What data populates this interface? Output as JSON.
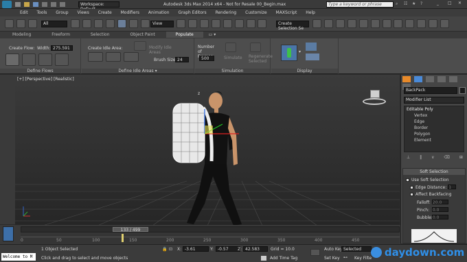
{
  "titlebar": {
    "workspace": "Workspace: Default",
    "title": "Autodesk 3ds Max  2014 x64  - Not for Resale   00_Begin.max",
    "search_placeholder": "Type a keyword or phrase"
  },
  "menu": [
    "Edit",
    "Tools",
    "Group",
    "Views",
    "Create",
    "Modifiers",
    "Animation",
    "Graph Editors",
    "Rendering",
    "Customize",
    "MAXScript",
    "Help"
  ],
  "toolbar": {
    "selection_filter": "All",
    "ref_coord": "View",
    "named_selection": "Create Selection Se"
  },
  "ribbon": {
    "tabs": [
      "Modeling",
      "Freeform",
      "Selection",
      "Object Paint",
      "Populate"
    ],
    "active_tab": "Populate",
    "create_flow_label": "Create Flow:",
    "width_label": "Width:",
    "width_value": "275.591",
    "create_idle_label": "Create Idle Area:",
    "modify_idle_label": "Modify Idle Areas",
    "brush_size_label": "Brush Size:",
    "brush_size_value": "24",
    "frames_label": "Number of Frames:",
    "frames_value": "500",
    "simulate_label": "Simulate",
    "regenerate_label": "Regenerate Selected",
    "groups": [
      "Define Flows",
      "Define Idle Areas",
      "Simulation",
      "Display"
    ]
  },
  "viewport": {
    "label": "[+] [Perspective] [Realistic]",
    "gizmo_label": "z"
  },
  "cmdpanel": {
    "object_name": "BackPack",
    "modifier_list": "Modifier List",
    "stack": [
      "Editable Poly",
      "Vertex",
      "Edge",
      "Border",
      "Polygon",
      "Element"
    ],
    "rollout_title": "Soft Selection",
    "use_soft": "Use Soft Selection",
    "edge_distance": "Edge Distance:",
    "edge_distance_value": "1",
    "affect_backfacing": "Affect Backfacing",
    "falloff": "Falloff:",
    "falloff_value": "20.0",
    "pinch": "Pinch:",
    "pinch_value": "0.0",
    "bubble": "Bubble:",
    "bubble_value": "0.0"
  },
  "timeline": {
    "frame_display": "133 / 499",
    "ticks": [
      "0",
      "50",
      "100",
      "150",
      "200",
      "250",
      "300",
      "350",
      "400",
      "450"
    ],
    "current_frame_fraction": 0.2665
  },
  "status": {
    "welcome": "Welcome to M",
    "selected": "1 Object Selected",
    "prompt": "Click and drag to select and move objects",
    "x_label": "X:",
    "x_value": "-3.61",
    "y_label": "Y:",
    "y_value": "-0.57",
    "z_label": "Z:",
    "z_value": "42.583",
    "grid": "Grid = 10.0",
    "add_time_tag": "Add Time Tag",
    "auto_key": "Auto Key",
    "set_key": "Set Key",
    "selected_dropdown": "Selected",
    "key_filters": "Key Filte",
    "watermark": "daydown.com"
  }
}
